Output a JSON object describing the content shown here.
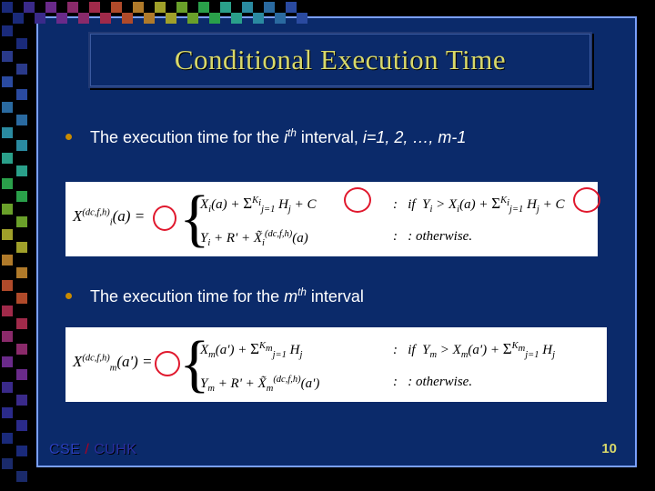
{
  "title": "Conditional Execution Time",
  "bullets": {
    "b1": {
      "pre": "The execution time for the ",
      "ith": "i",
      "sup": "th",
      "mid": " interval,  ",
      "range": "i=1, 2, …, m-1"
    },
    "b2": {
      "pre": "The execution time for the ",
      "mth": "m",
      "sup": "th",
      "post": " interval"
    }
  },
  "eq1": {
    "lhs_sym": "X",
    "lhs_sub": "i",
    "lhs_sup": "(dc,f,h)",
    "lhs_arg": "(a)",
    "line1": "X_i(a) + Σ_{j=1}^{K_i} H_j + C",
    "cond1_pre": ":   if  Y_i > X_i(a) + Σ_{j=1}^{K_i} H_j + C",
    "line2": "Y_i + R' + X̃_i^{(dc,f,h)}(a)",
    "cond2": ":   otherwise."
  },
  "eq2": {
    "lhs_sym": "X",
    "lhs_sub": "m",
    "lhs_sup": "(dc,f,h)",
    "lhs_arg": "(a')",
    "line1": "X_m(a') + Σ_{j=1}^{K_m} H_j",
    "cond1_pre": ":   if  Y_m > X_m(a') + Σ_{j=1}^{K_m} H_j",
    "line2": "Y_m + R' + X̃_m^{(dc,f,h)}(a')",
    "cond2": ":   otherwise."
  },
  "footer": {
    "cse": "CSE",
    "sep": " / ",
    "cuhk": "CUHK"
  },
  "page": "10",
  "deco": {
    "top_colors": [
      "#1a2a7a",
      "#3a2a8a",
      "#6a2a8a",
      "#8a2a6a",
      "#a02a4a",
      "#b04a2a",
      "#b07a2a",
      "#a0a02a",
      "#6aa02a",
      "#2aa04a",
      "#2aa08a",
      "#2a8aa0",
      "#2a6aa0",
      "#2a4aa0"
    ],
    "left_colors": [
      "#1a2a7a",
      "#2a3a8a",
      "#2a4aa0",
      "#2a6aa0",
      "#2a8aa0",
      "#2aa08a",
      "#2aa04a",
      "#6aa02a",
      "#a0a02a",
      "#b07a2a",
      "#b04a2a",
      "#a02a4a",
      "#8a2a6a",
      "#6a2a8a",
      "#3a2a8a",
      "#2a2a8a",
      "#1a2a7a",
      "#1a2a6a"
    ]
  }
}
